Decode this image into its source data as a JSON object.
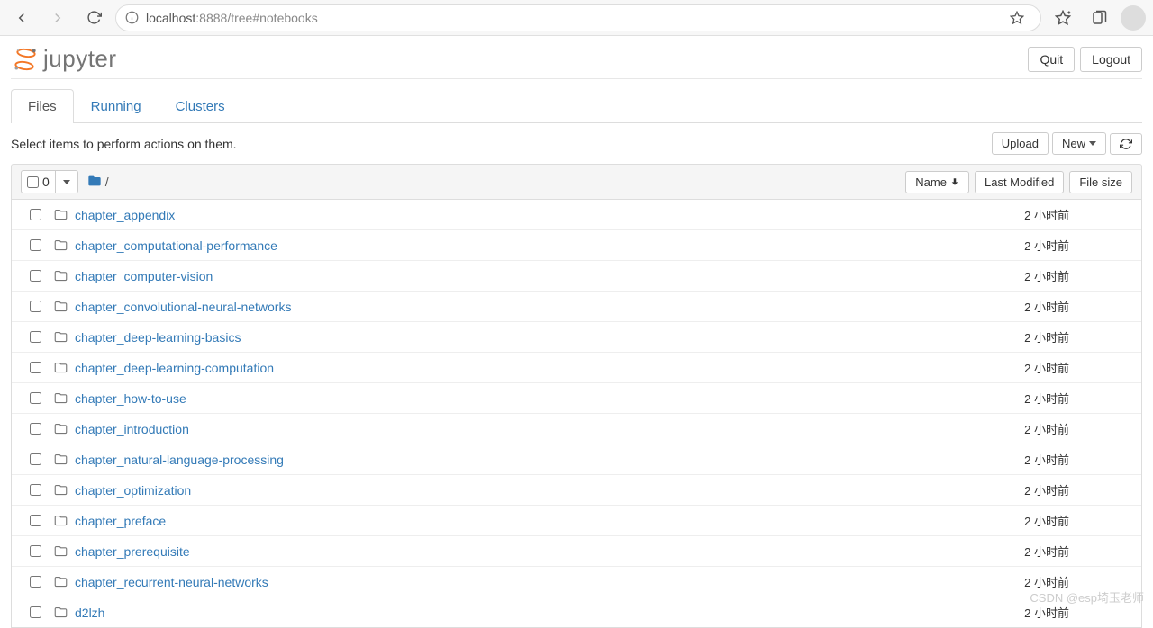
{
  "browser": {
    "url_host": "localhost",
    "url_port": ":8888",
    "url_path": "/tree#notebooks"
  },
  "header": {
    "brand": "jupyter",
    "quit_label": "Quit",
    "logout_label": "Logout"
  },
  "tabs": [
    {
      "label": "Files",
      "active": true
    },
    {
      "label": "Running",
      "active": false
    },
    {
      "label": "Clusters",
      "active": false
    }
  ],
  "actions": {
    "hint": "Select items to perform actions on them.",
    "upload_label": "Upload",
    "new_label": "New",
    "refresh_title": "Refresh"
  },
  "list_header": {
    "selected_count": "0",
    "breadcrumb_root": "/",
    "sort_name": "Name",
    "sort_modified": "Last Modified",
    "sort_size": "File size"
  },
  "files": [
    {
      "name": "chapter_appendix",
      "type": "folder",
      "modified": "2 小时前"
    },
    {
      "name": "chapter_computational-performance",
      "type": "folder",
      "modified": "2 小时前"
    },
    {
      "name": "chapter_computer-vision",
      "type": "folder",
      "modified": "2 小时前"
    },
    {
      "name": "chapter_convolutional-neural-networks",
      "type": "folder",
      "modified": "2 小时前"
    },
    {
      "name": "chapter_deep-learning-basics",
      "type": "folder",
      "modified": "2 小时前"
    },
    {
      "name": "chapter_deep-learning-computation",
      "type": "folder",
      "modified": "2 小时前"
    },
    {
      "name": "chapter_how-to-use",
      "type": "folder",
      "modified": "2 小时前"
    },
    {
      "name": "chapter_introduction",
      "type": "folder",
      "modified": "2 小时前"
    },
    {
      "name": "chapter_natural-language-processing",
      "type": "folder",
      "modified": "2 小时前"
    },
    {
      "name": "chapter_optimization",
      "type": "folder",
      "modified": "2 小时前"
    },
    {
      "name": "chapter_preface",
      "type": "folder",
      "modified": "2 小时前"
    },
    {
      "name": "chapter_prerequisite",
      "type": "folder",
      "modified": "2 小时前"
    },
    {
      "name": "chapter_recurrent-neural-networks",
      "type": "folder",
      "modified": "2 小时前"
    },
    {
      "name": "d2lzh",
      "type": "folder",
      "modified": "2 小时前"
    }
  ],
  "watermark": "CSDN @esp埼玉老师"
}
